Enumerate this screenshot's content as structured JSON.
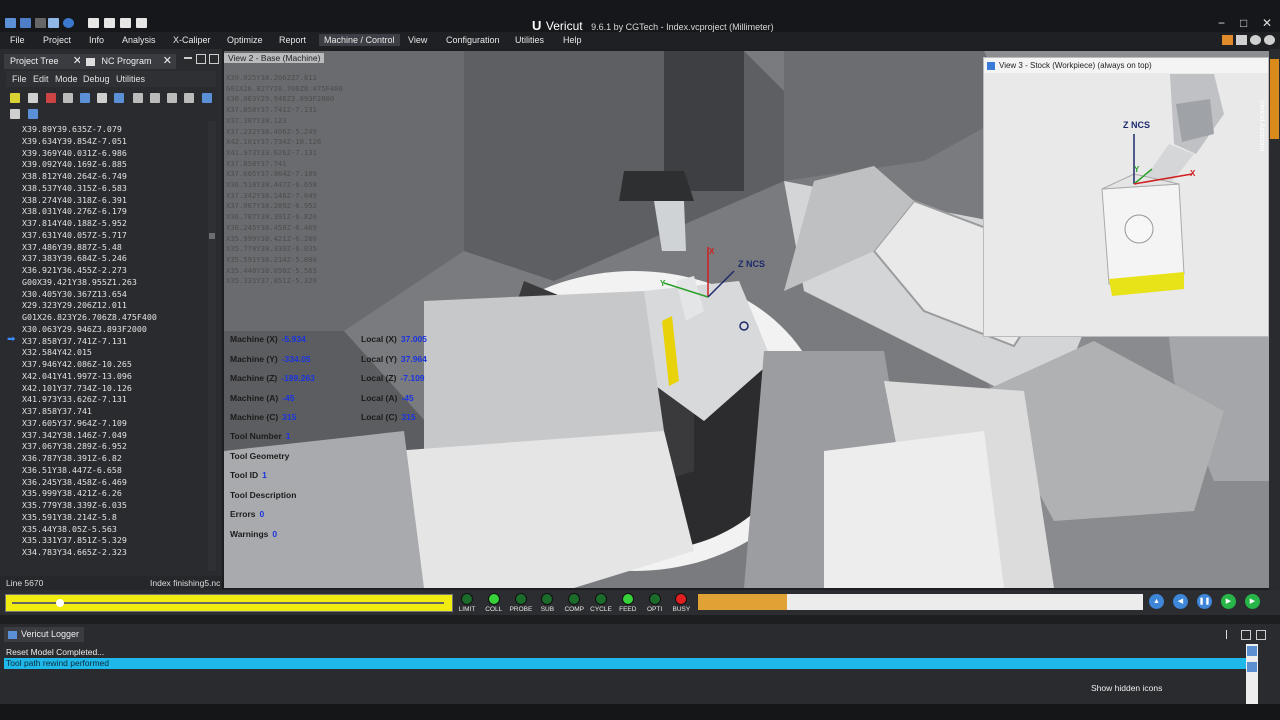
{
  "title_bar": {
    "logo": "U",
    "app_name": "Vericut",
    "caption": "9.6.1 by CGTech - Index.vcproject (Millimeter)",
    "min_icon": "minimize-icon",
    "max_icon": "maximize-icon",
    "close_icon": "close-icon",
    "min_glyph": "−",
    "max_glyph": "□",
    "close_glyph": "✕"
  },
  "menu": {
    "items": [
      "File",
      "Project",
      "Info",
      "Analysis",
      "X-Caliper",
      "Optimize",
      "Report",
      "Machine / Control",
      "View",
      "Configuration",
      "Utilities",
      "Help"
    ],
    "active": "Machine / Control"
  },
  "left_panel": {
    "tabs": [
      {
        "label": "Project Tree",
        "close": "✕"
      },
      {
        "label": "NC Program",
        "close": "✕"
      }
    ],
    "submenu": [
      "File",
      "Edit",
      "Mode",
      "Debug",
      "Utilities"
    ],
    "nc_lines": [
      "X39.89Y39.635Z-7.079",
      "X39.634Y39.854Z-7.051",
      "X39.369Y40.031Z-6.986",
      "X39.092Y40.169Z-6.885",
      "X38.812Y40.264Z-6.749",
      "X38.537Y40.315Z-6.583",
      "X38.274Y40.318Z-6.391",
      "X38.031Y40.276Z-6.179",
      "X37.814Y40.188Z-5.952",
      "X37.631Y40.057Z-5.717",
      "X37.486Y39.887Z-5.48",
      "X37.383Y39.684Z-5.246",
      "X36.921Y36.455Z-2.273",
      "G00X39.421Y38.955Z1.263",
      "X30.405Y30.367Z13.654",
      "X29.323Y29.206Z12.011",
      "G01X26.823Y26.706Z8.475F400",
      "X30.063Y29.946Z3.893F2000",
      "X37.858Y37.741Z-7.131",
      "X32.584Y42.015",
      "X37.946Y42.086Z-10.265",
      "X42.041Y41.997Z-13.096",
      "X42.101Y37.734Z-10.126",
      "X41.973Y33.626Z-7.131",
      "X37.858Y37.741",
      "X37.605Y37.964Z-7.109",
      "X37.342Y38.146Z-7.049",
      "X37.067Y38.289Z-6.952",
      "X36.787Y38.391Z-6.82",
      "X36.51Y38.447Z-6.658",
      "X36.245Y38.458Z-6.469",
      "X35.999Y38.421Z-6.26",
      "X35.779Y38.339Z-6.035",
      "X35.591Y38.214Z-5.8",
      "X35.44Y38.05Z-5.563",
      "X35.331Y37.851Z-5.329",
      "X34.783Y34.665Z-2.323"
    ],
    "current_line_index": 18,
    "current_marker": "➡",
    "line_label": "Line 5670",
    "file_label": "Index finishing5.nc"
  },
  "viewport": {
    "title": "View 2 - Base (Machine)",
    "znc_label": "Z NCS",
    "axis_x": "X",
    "axis_y": "Y",
    "ghost_lines": [
      "X39.025Y38.2062Z7.811",
      "G01X26.827Y26.706Z8.475F400",
      "X30.063Y29.946Z3.893F2000",
      "X37.858Y37.741Z-7.131",
      "X37.307Y38.123",
      "X37.232Y38.406Z-5.249",
      "X42.101Y37.734Z-10.126",
      "X41.973Y33.626Z-7.131",
      "X37.858Y37.741",
      "X37.605Y37.964Z-7.109",
      "X36.510Y38.447Z-6.658",
      "X37.342Y38.146Z-7.049",
      "X37.067Y38.289Z-6.952",
      "X36.787Y38.391Z-6.820",
      "X36.245Y38.458Z-6.469",
      "X35.999Y38.421Z-6.260",
      "X35.779Y38.339Z-6.035",
      "X35.591Y38.214Z-5.800",
      "X35.440Y38.050Z-5.563",
      "X35.331Y37.851Z-5.329"
    ],
    "machine_info": [
      {
        "label": "Machine (X)",
        "value": "-5.934"
      },
      {
        "label": "Machine (Y)",
        "value": "-334.05"
      },
      {
        "label": "Machine (Z)",
        "value": "-189.263"
      },
      {
        "label": "Machine (A)",
        "value": "-45"
      },
      {
        "label": "Machine (C)",
        "value": "315"
      }
    ],
    "local_info": [
      {
        "label": "Local (X)",
        "value": "37.005"
      },
      {
        "label": "Local (Y)",
        "value": "37.964"
      },
      {
        "label": "Local (Z)",
        "value": "-7.109"
      },
      {
        "label": "Local (A)",
        "value": "-45"
      },
      {
        "label": "Local (C)",
        "value": "315"
      }
    ],
    "tool_info": [
      {
        "label": "Tool Number",
        "value": "1"
      },
      {
        "label": "Tool Geometry",
        "value": ""
      },
      {
        "label": "Tool ID",
        "value": "1"
      },
      {
        "label": "Tool Description",
        "value": ""
      },
      {
        "label": "Errors",
        "value": "0"
      },
      {
        "label": "Warnings",
        "value": "0"
      }
    ]
  },
  "inset_view": {
    "title": "View 3 - Stock (Workpiece) (always on top)",
    "znc_label": "Z NCS",
    "axis_y": "Y",
    "axis_x": "X"
  },
  "right_strip": {
    "label": "Vericut Assistant",
    "accent": "#d88a1a"
  },
  "sim_bar": {
    "slider_fraction": 0.11,
    "leds": [
      {
        "label": "LIMIT",
        "color": "#1e9a32",
        "state": "off"
      },
      {
        "label": "COLL",
        "color": "#37d13a",
        "state": "on"
      },
      {
        "label": "PROBE",
        "color": "#1e9a32",
        "state": "off"
      },
      {
        "label": "SUB",
        "color": "#1e9a32",
        "state": "off"
      },
      {
        "label": "COMP",
        "color": "#1e9a32",
        "state": "off"
      },
      {
        "label": "CYCLE",
        "color": "#1e9a32",
        "state": "off"
      },
      {
        "label": "FEED",
        "color": "#37d13a",
        "state": "on"
      },
      {
        "label": "OPTI",
        "color": "#1e9a32",
        "state": "off"
      },
      {
        "label": "BUSY",
        "color": "#e02020",
        "state": "on"
      }
    ],
    "progress_fraction": 0.2,
    "progress_color": "#e0a135",
    "buttons": [
      {
        "name": "reset-model-button",
        "icon": "rewind-up-icon",
        "glyph": "▲",
        "color": "#3e86d8"
      },
      {
        "name": "play-to-start-button",
        "icon": "step-back-icon",
        "glyph": "◀",
        "color": "#3e86d8"
      },
      {
        "name": "pause-button",
        "icon": "pause-icon",
        "glyph": "❚❚",
        "color": "#3e86d8"
      },
      {
        "name": "single-step-button",
        "icon": "step-forward-icon",
        "glyph": "▶",
        "color": "#28b548"
      },
      {
        "name": "play-button",
        "icon": "play-icon",
        "glyph": "▶",
        "color": "#28b548"
      }
    ]
  },
  "logger": {
    "tab_label": "Vericut Logger",
    "messages": [
      "Reset Model Completed...",
      "Tool path rewind performed"
    ],
    "show_hidden": "Show hidden icons",
    "highlight_color": "#1fb8ea"
  }
}
